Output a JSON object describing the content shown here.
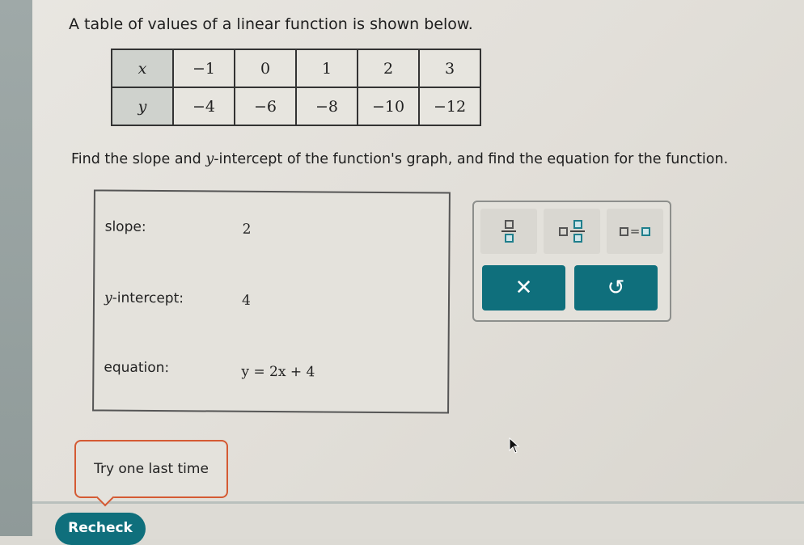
{
  "intro_text": "A table of values of a linear function is shown below.",
  "table": {
    "x_label": "x",
    "y_label": "y",
    "x_values": [
      "−1",
      "0",
      "1",
      "2",
      "3"
    ],
    "y_values": [
      "−4",
      "−6",
      "−8",
      "−10",
      "−12"
    ]
  },
  "prompt": {
    "before": "Find the slope and ",
    "var": "y",
    "after": "-intercept of the function's graph, and find the equation for the function."
  },
  "answers": {
    "slope_label": "slope:",
    "slope_value": "2",
    "intercept_var": "y",
    "intercept_label": "-intercept:",
    "intercept_value": "4",
    "equation_label": "equation:",
    "equation_value": "y = 2x + 4"
  },
  "palette": {
    "buttons": [
      "fraction",
      "mixed-number",
      "equation"
    ],
    "clear_symbol": "✕",
    "undo_symbol": "↺"
  },
  "feedback": {
    "tooltip_text": "Try one last time"
  },
  "footer": {
    "recheck_label": "Recheck"
  },
  "colors": {
    "accent": "#0f6f7c",
    "warning_border": "#d45a33"
  }
}
